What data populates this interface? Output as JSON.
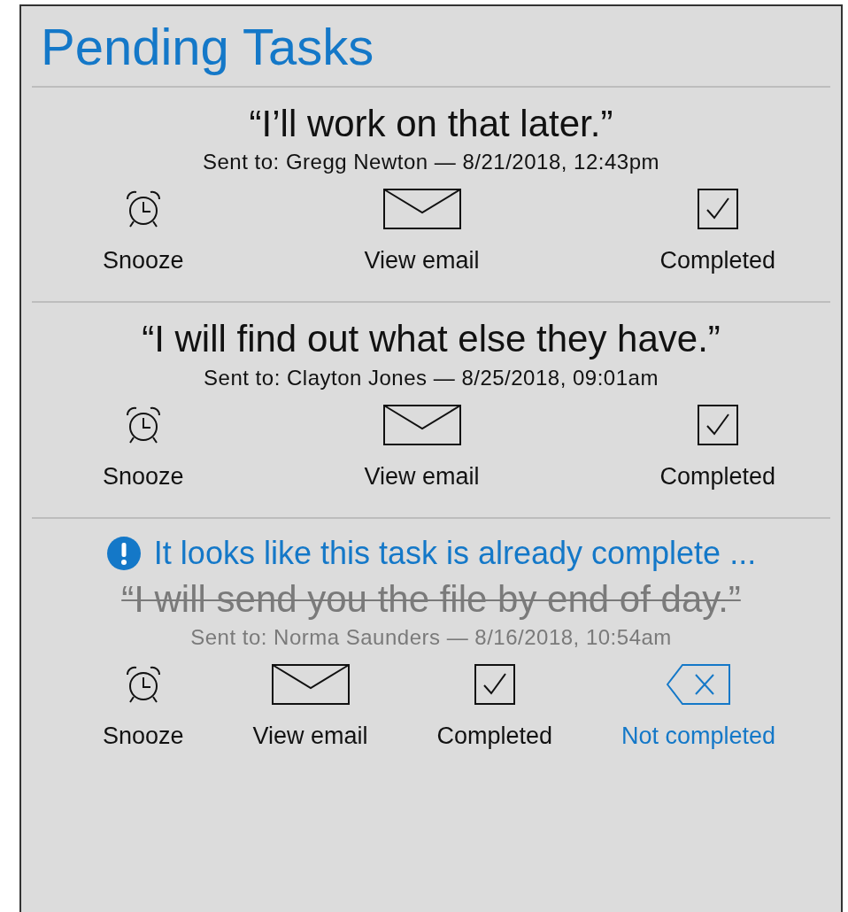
{
  "title": "Pending Tasks",
  "tasks": [
    {
      "quote": "“I’ll work on that later.”",
      "sent_to": "Sent to: Gregg Newton — 8/21/2018, 12:43pm",
      "crossed_out": false,
      "actions": [
        {
          "kind": "snooze",
          "label": "Snooze"
        },
        {
          "kind": "email",
          "label": "View email"
        },
        {
          "kind": "complete",
          "label": "Completed"
        }
      ]
    },
    {
      "quote": "“I will find out what else they have.”",
      "sent_to": "Sent to: Clayton Jones — 8/25/2018, 09:01am",
      "crossed_out": false,
      "actions": [
        {
          "kind": "snooze",
          "label": "Snooze"
        },
        {
          "kind": "email",
          "label": "View email"
        },
        {
          "kind": "complete",
          "label": "Completed"
        }
      ]
    },
    {
      "alert": "It looks like this task is already complete ...",
      "quote": "“I will send you the file by end of day.”",
      "sent_to": "Sent to: Norma Saunders — 8/16/2018, 10:54am",
      "crossed_out": true,
      "actions": [
        {
          "kind": "snooze",
          "label": "Snooze"
        },
        {
          "kind": "email",
          "label": "View email"
        },
        {
          "kind": "complete",
          "label": "Completed"
        },
        {
          "kind": "undo",
          "label": "Not completed"
        }
      ]
    }
  ]
}
